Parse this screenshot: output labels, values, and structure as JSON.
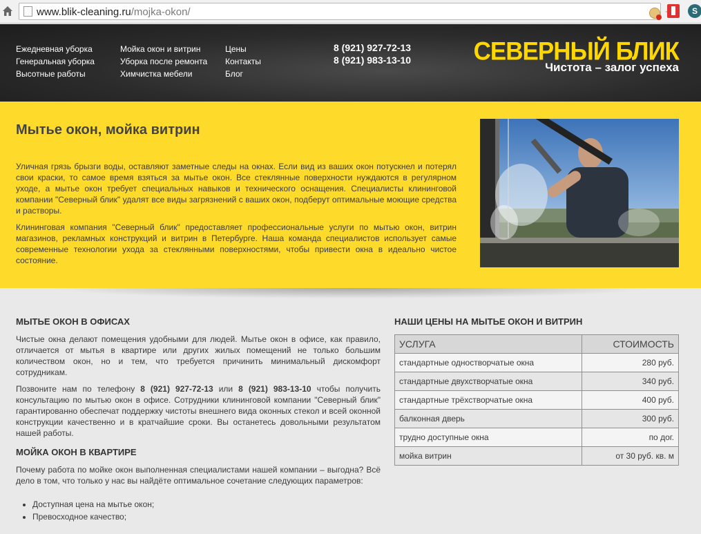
{
  "browser": {
    "url_domain": "www.blik-cleaning.ru",
    "url_path": "/mojka-okon/"
  },
  "nav": {
    "col1": [
      "Ежедневная уборка",
      "Генеральная уборка",
      "Высотные работы"
    ],
    "col2": [
      "Мойка окон и витрин",
      "Уборка после ремонта",
      "Химчистка мебели"
    ],
    "col3": [
      "Цены",
      "Контакты",
      "Блог"
    ]
  },
  "header": {
    "phone1": "8 (921) 927-72-13",
    "phone2": "8 (921) 983-13-10",
    "brand": "СЕВЕРНЫЙ БЛИК",
    "slogan": "Чистота – залог успеха"
  },
  "hero": {
    "title": "Мытье окон, мойка витрин",
    "p1": "Уличная грязь брызги воды, оставляют заметные следы на окнах. Если вид из ваших окон потускнел и потерял свои краски, то самое время взяться за мытье окон. Все стеклянные поверхности нуждаются в регулярном уходе, а мытье окон требует специальных навыков и технического оснащения. Специалисты клининговой компании \"Северный блик\" удалят все виды загрязнений с ваших окон, подберут оптимальные моющие средства и растворы.",
    "p2": "Клининговая компания \"Северный блик\" предоставляет профессиональные услуги по мытью окон, витрин магазинов, рекламных конструкций и витрин в Петербурге. Наша команда специалистов использует самые современные технологии ухода за стеклянными поверхностями, чтобы привести окна в идеально чистое состояние."
  },
  "offices": {
    "title": "МЫТЬЕ ОКОН В ОФИСАХ",
    "p1": "Чистые окна делают помещения удобными для людей. Мытье окон в офисе, как правило, отличается от мытья в квартире или других жилых помещений не только большим количеством окон, но и тем, что требуется причинить минимальный дискомфорт сотрудникам.",
    "p2_before": "Позвоните нам по телефону ",
    "p2_phone1": "8 (921) 927-72-13",
    "p2_mid": " или ",
    "p2_phone2": "8 (921) 983-13-10",
    "p2_after": " чтобы получить консультацию по мытью окон в офисе. Сотрудники клининговой компании \"Северный блик\" гарантированно обеспечат поддержку чистоты внешнего вида оконных стекол и всей оконной конструкции качественно и в кратчайшие сроки. Вы останетесь довольными результатом нашей работы."
  },
  "apartment": {
    "title": "МОЙКА ОКОН В КВАРТИРЕ",
    "p1": "Почему работа по мойке окон выполненная специалистами нашей компании – выгодна? Всё дело в том, что только у нас вы найдёте оптимальное сочетание следующих параметров:",
    "list": [
      "Доступная цена на мытье окон;",
      "Превосходное качество;"
    ]
  },
  "prices": {
    "title": "НАШИ ЦЕНЫ НА МЫТЬЕ ОКОН И ВИТРИН",
    "col_service": "УСЛУГА",
    "col_price": "СТОИМОСТЬ",
    "rows": [
      {
        "service": "стандартные одностворчатые окна",
        "price": "280 руб."
      },
      {
        "service": "стандартные двухстворчатые окна",
        "price": "340 руб."
      },
      {
        "service": "стандартные трёхстворчатые окна",
        "price": "400 руб."
      },
      {
        "service": "балконная дверь",
        "price": "300 руб."
      },
      {
        "service": "трудно доступные окна",
        "price": "по дог."
      },
      {
        "service": "мойка витрин",
        "price": "от 30 руб. кв. м"
      }
    ]
  },
  "colors": {
    "accent_yellow": "#fedb2a",
    "brand_yellow": "#ffd700",
    "header_dark": "#2b2b2b"
  }
}
